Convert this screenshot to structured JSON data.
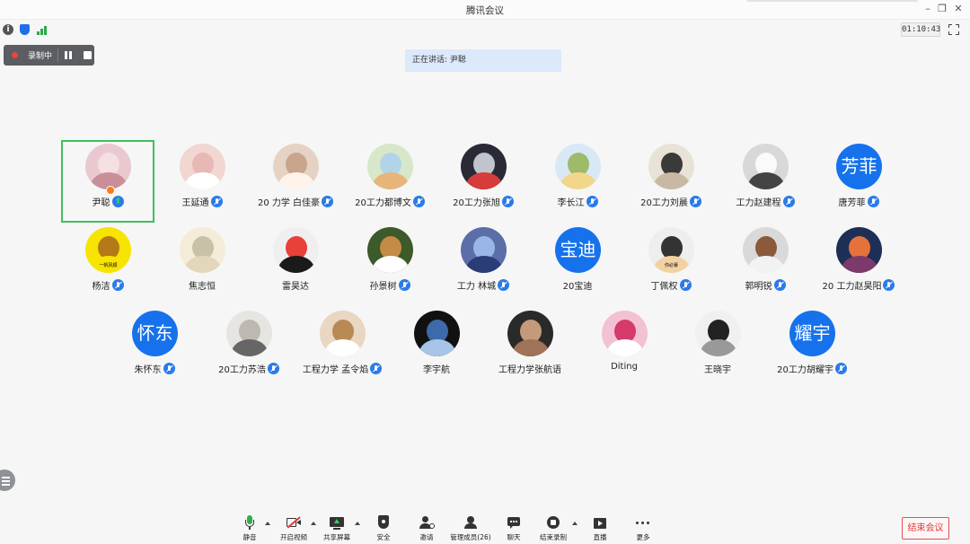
{
  "window": {
    "title": "腾讯会议"
  },
  "timer": "01:10:43",
  "recording": {
    "label": "录制中"
  },
  "speaking": {
    "text": "正在讲话: 尹聪"
  },
  "participants": [
    {
      "name": "尹聪",
      "mic": "on",
      "host": true,
      "active": true,
      "avatar": "photo"
    },
    {
      "name": "王延通",
      "mic": "off",
      "avatar": "photo"
    },
    {
      "name": "20 力学 白佳豪",
      "mic": "off",
      "avatar": "photo"
    },
    {
      "name": "20工力都博文",
      "mic": "off",
      "avatar": "photo"
    },
    {
      "name": "20工力张旭",
      "mic": "off",
      "avatar": "photo"
    },
    {
      "name": "李长江",
      "mic": "off",
      "avatar": "photo"
    },
    {
      "name": "20工力刘晨",
      "mic": "off",
      "avatar": "photo"
    },
    {
      "name": "工力赵建程",
      "mic": "off",
      "avatar": "photo"
    },
    {
      "name": "唐芳菲",
      "mic": "off",
      "avatar": "text",
      "avatar_text": "芳菲"
    },
    {
      "name": "杨洁",
      "mic": "off",
      "avatar": "photo",
      "avatar_caption": "一帆风顺"
    },
    {
      "name": "焦志恒",
      "mic": "none",
      "avatar": "photo"
    },
    {
      "name": "雷昊达",
      "mic": "none",
      "avatar": "photo"
    },
    {
      "name": "孙景树",
      "mic": "off",
      "avatar": "photo"
    },
    {
      "name": "工力 林城",
      "mic": "off",
      "avatar": "photo"
    },
    {
      "name": "20宝迪",
      "mic": "none",
      "avatar": "text",
      "avatar_text": "宝迪"
    },
    {
      "name": "丁佩权",
      "mic": "off",
      "avatar": "photo",
      "avatar_caption": "你必暴"
    },
    {
      "name": "郭明锐",
      "mic": "off",
      "avatar": "photo"
    },
    {
      "name": "20 工力赵昊阳",
      "mic": "off",
      "avatar": "photo"
    },
    {
      "name": "朱怀东",
      "mic": "off",
      "avatar": "text",
      "avatar_text": "怀东"
    },
    {
      "name": "20工力苏浩",
      "mic": "off",
      "avatar": "photo"
    },
    {
      "name": "工程力学 孟令焰",
      "mic": "off",
      "avatar": "photo"
    },
    {
      "name": "李宇航",
      "mic": "none",
      "avatar": "photo"
    },
    {
      "name": "工程力学张航语",
      "mic": "none",
      "avatar": "photo"
    },
    {
      "name": "Diting",
      "mic": "none",
      "avatar": "photo"
    },
    {
      "name": "王晓宇",
      "mic": "none",
      "avatar": "photo"
    },
    {
      "name": "20工力胡耀宇",
      "mic": "off",
      "avatar": "text",
      "avatar_text": "耀宇"
    }
  ],
  "toolbar": {
    "mute": "静音",
    "video": "开启视频",
    "share": "共享屏幕",
    "security": "安全",
    "invite": "邀请",
    "members": "管理成员(26)",
    "chat": "聊天",
    "end_recording": "结束录制",
    "live": "直播",
    "more": "更多",
    "end_meeting": "结束会议"
  },
  "colors": {
    "accent": "#1672ec",
    "active_border": "#3fbf5f",
    "end_red": "#e03b3b"
  }
}
